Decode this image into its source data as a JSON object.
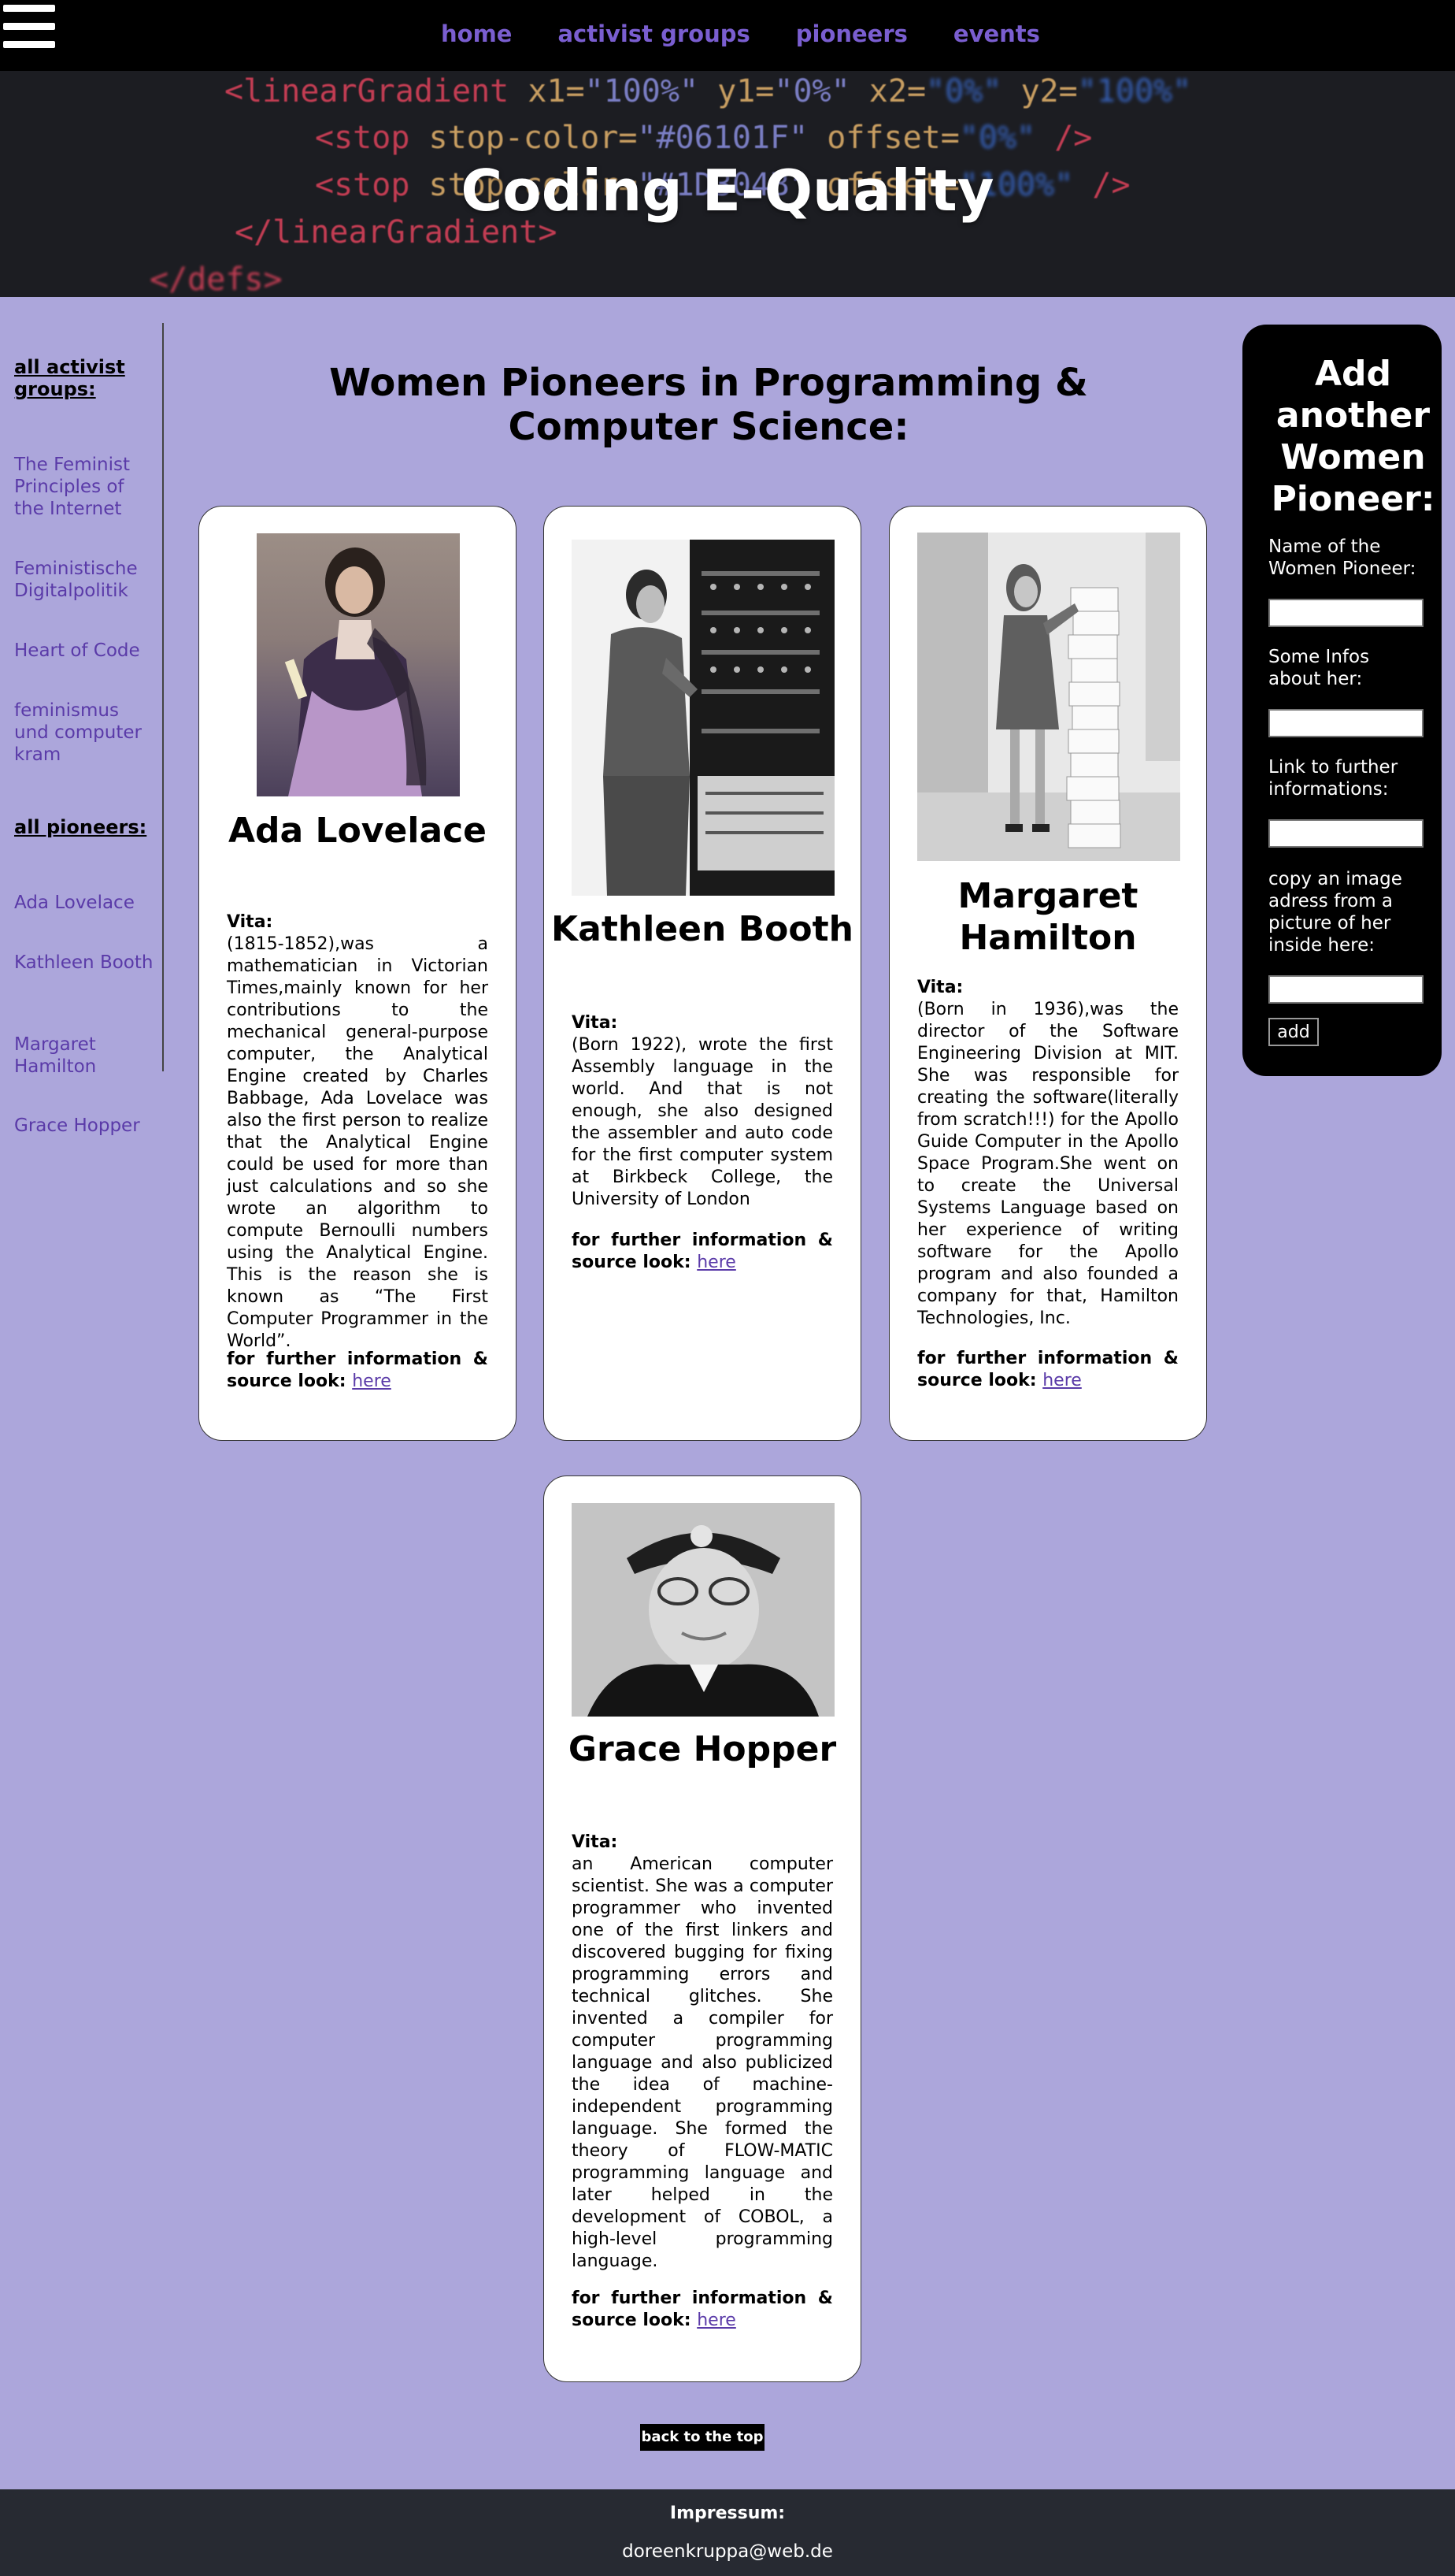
{
  "nav": {
    "links": [
      "home",
      "activist groups",
      "pioneers",
      "events"
    ],
    "link_color": "#7a5ed0"
  },
  "hero": {
    "title": "Coding E-Quality",
    "code_lines": [
      {
        "tag": "<linearGradient",
        "parts": [
          " x1=",
          "\"100%\"",
          " y1=",
          "\"0%\"",
          " x2=",
          "\"0%\"",
          " y2=",
          "\"100%\""
        ]
      },
      {
        "tag": "<stop",
        "parts": [
          " stop-color=",
          "\"#06101F\"",
          " offset=",
          "\"0%\"",
          " />"
        ]
      },
      {
        "tag": "<stop",
        "parts": [
          " stop-color=",
          "\"#1D304B\"",
          " offset=",
          "\"100%\"",
          " />"
        ]
      },
      {
        "tag": "</linearGradient>",
        "parts": []
      },
      {
        "tag": "</defs>",
        "parts": []
      }
    ]
  },
  "sidebar": {
    "groups_heading": "all activist groups:",
    "groups": [
      "The Feminist Principles of the Internet",
      "Feministische Digitalpolitik",
      "Heart of Code",
      "feminismus und computer kram"
    ],
    "pioneers_heading": "all pioneers:",
    "pioneers": [
      "Ada Lovelace",
      "Kathleen Booth",
      "Margaret Hamilton",
      "Grace Hopper"
    ]
  },
  "main": {
    "title": "Women Pioneers in Programming & Computer Science:",
    "vita_label": "Vita:",
    "more_label": "for further information & source look:",
    "link_label": "here",
    "pioneers": [
      {
        "name": "Ada Lovelace",
        "vita": "(1815-1852),was a mathematician in Victorian Times,mainly known for her contributions to the mechanical general-purpose computer, the Analytical Engine created by Charles Babbage, Ada Lovelace was also the first person to realize that the Analytical Engine could be used for more than just calculations and so she wrote an algorithm to compute Bernoulli numbers using the Analytical Engine. This is the reason she is known as “The First Computer Programmer in the World”."
      },
      {
        "name": "Kathleen Booth",
        "vita": "(Born 1922), wrote the first Assembly language in the world. And that is not enough, she also designed the assembler and auto code for the first computer system at Birkbeck College, the University of London"
      },
      {
        "name": "Margaret Hamilton",
        "vita": "(Born in 1936),was the director of the Software Engineering Division at MIT. She was responsible for creating the software(literally from scratch!!!) for the Apollo Guide Computer in the Apollo Space Program.She went on to create the Universal Systems Language based on her experience of writing software for the Apollo program and also founded a company for that, Hamilton Technologies, Inc."
      },
      {
        "name": "Grace Hopper",
        "vita": "an American computer scientist. She was a computer programmer who invented one of the first linkers and discovered bugging for fixing programming errors and technical glitches. She invented a compiler for computer programming language and also publicized the idea of machine-independent programming language. She formed the theory of FLOW-MATIC programming language and later helped in the development of COBOL, a high-level programming language."
      }
    ]
  },
  "form": {
    "title": "Add another Women Pioneer:",
    "name_label": "Name of the Women Pioneer:",
    "info_label": "Some Infos about her:",
    "link_label": "Link to further informations:",
    "image_label": "copy an image adress from a picture of her inside here:",
    "add_label": "add"
  },
  "back_to_top": "back to the top",
  "footer": {
    "impressum": "Impressum:",
    "email": "doreenkruppa@web.de"
  }
}
